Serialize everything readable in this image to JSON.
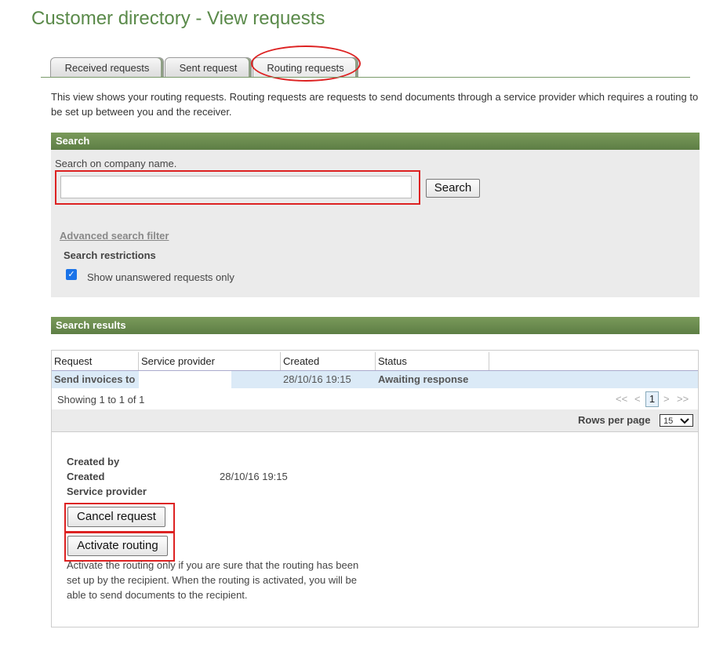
{
  "page": {
    "title": "Customer directory - View requests"
  },
  "tabs": [
    "Received requests",
    "Sent request",
    "Routing requests"
  ],
  "intro": "This view shows your routing requests. Routing requests are requests to send documents through a service provider which requires a routing to be set up between you and the receiver.",
  "search": {
    "header": "Search",
    "label": "Search on company name.",
    "value": "",
    "button": "Search",
    "advanced_link": "Advanced search filter",
    "restrictions_label": "Search restrictions",
    "checkbox_label": "Show unanswered requests only",
    "checkbox_checked": true
  },
  "results": {
    "header": "Search results",
    "columns": [
      "Request",
      "Service provider",
      "Created",
      "Status"
    ],
    "rows": [
      {
        "request": "Send invoices to",
        "service_provider": "",
        "created": "28/10/16 19:15",
        "status": "Awaiting response"
      }
    ],
    "showing": "Showing 1 to 1 of 1",
    "pager": {
      "first": "<<",
      "prev": "<",
      "current": "1",
      "next": ">",
      "last": ">>"
    },
    "rows_per_page_label": "Rows per page",
    "rows_per_page_value": "15"
  },
  "details": {
    "created_by_label": "Created by",
    "created_label": "Created",
    "created_value": "28/10/16 19:15",
    "service_provider_label": "Service provider",
    "cancel_button": "Cancel request",
    "activate_button": "Activate routing",
    "note": "Activate the routing only if you are sure that the routing has been set up by the recipient. When the routing is activated, you will be able to send documents to the recipient."
  },
  "colors": {
    "title": "#5a8a4a",
    "bar": "#5d7e45",
    "highlight": "#d22222",
    "row_selected": "#dbeaf7"
  }
}
